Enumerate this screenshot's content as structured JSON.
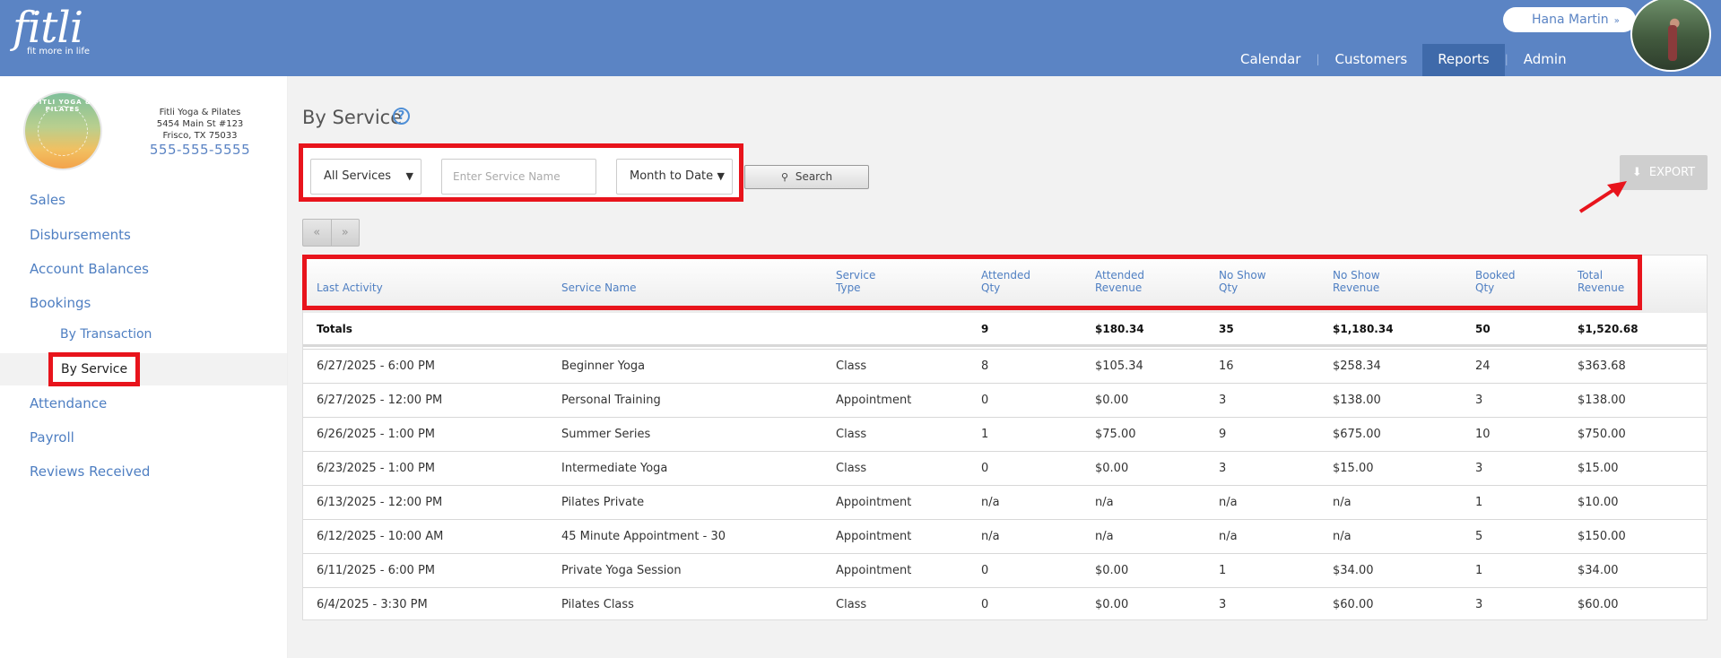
{
  "brand": {
    "name": "fitli",
    "tagline": "fit more in life"
  },
  "user": {
    "name": "Hana Martin",
    "chevron": "»"
  },
  "nav": [
    "Calendar",
    "Customers",
    "Reports",
    "Admin"
  ],
  "studio": {
    "logo_text": "FITLI YOGA & PILATES",
    "name": "Fitli Yoga & Pilates",
    "address1": "5454 Main St #123",
    "address2": "Frisco, TX 75033",
    "phone": "555-555-5555"
  },
  "sidebar": {
    "sales": "Sales",
    "disbursements": "Disbursements",
    "account_balances": "Account Balances",
    "bookings": "Bookings",
    "by_transaction": "By Transaction",
    "by_service": "By Service",
    "attendance": "Attendance",
    "payroll": "Payroll",
    "reviews": "Reviews Received"
  },
  "page": {
    "title": "By Service",
    "help": "?"
  },
  "filters": {
    "services_value": "All Services",
    "service_name_placeholder": "Enter Service Name",
    "period_value": "Month to Date",
    "search_label": "Search",
    "export_label": "EXPORT"
  },
  "pager": {
    "prev": "«",
    "next": "»"
  },
  "table": {
    "headers": [
      [
        "Last Activity"
      ],
      [
        "Service Name"
      ],
      [
        "Service",
        "Type"
      ],
      [
        "Attended",
        "Qty"
      ],
      [
        "Attended",
        "Revenue"
      ],
      [
        "No Show",
        "Qty"
      ],
      [
        "No Show",
        "Revenue"
      ],
      [
        "Booked",
        "Qty"
      ],
      [
        "Total",
        "Revenue"
      ]
    ],
    "totals": [
      "Totals",
      "",
      "",
      "9",
      "$180.34",
      "35",
      "$1,180.34",
      "50",
      "$1,520.68"
    ],
    "rows": [
      [
        "6/27/2025 - 6:00 PM",
        "Beginner Yoga",
        "Class",
        "8",
        "$105.34",
        "16",
        "$258.34",
        "24",
        "$363.68"
      ],
      [
        "6/27/2025 - 12:00 PM",
        "Personal Training",
        "Appointment",
        "0",
        "$0.00",
        "3",
        "$138.00",
        "3",
        "$138.00"
      ],
      [
        "6/26/2025 - 1:00 PM",
        "Summer Series",
        "Class",
        "1",
        "$75.00",
        "9",
        "$675.00",
        "10",
        "$750.00"
      ],
      [
        "6/23/2025 - 1:00 PM",
        "Intermediate Yoga",
        "Class",
        "0",
        "$0.00",
        "3",
        "$15.00",
        "3",
        "$15.00"
      ],
      [
        "6/13/2025 - 12:00 PM",
        "Pilates Private",
        "Appointment",
        "n/a",
        "n/a",
        "n/a",
        "n/a",
        "1",
        "$10.00"
      ],
      [
        "6/12/2025 - 10:00 AM",
        "45 Minute Appointment - 30",
        "Appointment",
        "n/a",
        "n/a",
        "n/a",
        "n/a",
        "5",
        "$150.00"
      ],
      [
        "6/11/2025 - 6:00 PM",
        "Private Yoga Session",
        "Appointment",
        "0",
        "$0.00",
        "1",
        "$34.00",
        "1",
        "$34.00"
      ],
      [
        "6/4/2025 - 3:30 PM",
        "Pilates Class",
        "Class",
        "0",
        "$0.00",
        "3",
        "$60.00",
        "3",
        "$60.00"
      ]
    ]
  }
}
